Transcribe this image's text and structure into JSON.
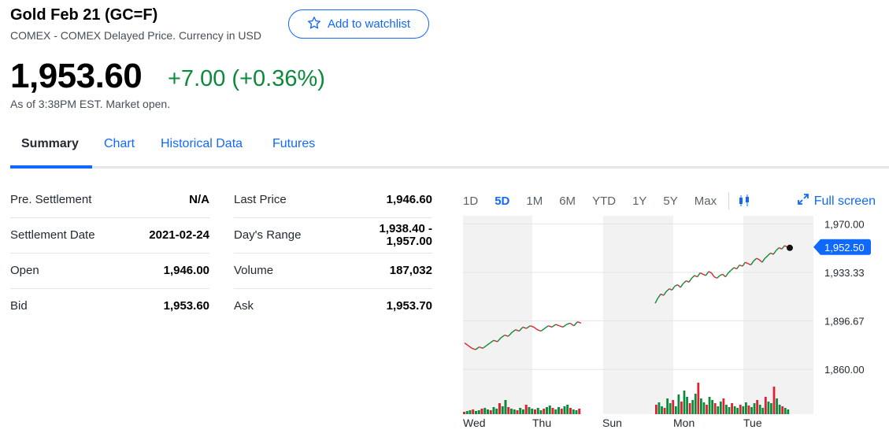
{
  "header": {
    "title": "Gold Feb 21 (GC=F)",
    "subtitle": "COMEX - COMEX Delayed Price. Currency in USD",
    "watchlist_label": "Add to watchlist",
    "price": "1,953.60",
    "change": "+7.00 (+0.36%)",
    "as_of": "As of 3:38PM EST. Market open."
  },
  "tabs": [
    {
      "label": "Summary",
      "active": true
    },
    {
      "label": "Chart"
    },
    {
      "label": "Historical Data"
    },
    {
      "label": "Futures"
    }
  ],
  "stats_left": [
    {
      "label": "Pre. Settlement",
      "value": "N/A"
    },
    {
      "label": "Settlement Date",
      "value": "2021-02-24"
    },
    {
      "label": "Open",
      "value": "1,946.00"
    },
    {
      "label": "Bid",
      "value": "1,953.60"
    }
  ],
  "stats_right": [
    {
      "label": "Last Price",
      "value": "1,946.60"
    },
    {
      "label": "Day's Range",
      "value": "1,938.40 -\n1,957.00"
    },
    {
      "label": "Volume",
      "value": "187,032"
    },
    {
      "label": "Ask",
      "value": "1,953.70"
    }
  ],
  "chart_controls": {
    "ranges": [
      "1D",
      "5D",
      "1M",
      "6M",
      "YTD",
      "1Y",
      "5Y",
      "Max"
    ],
    "active_range": "5D",
    "full_screen_label": "Full screen",
    "chart_type_icon": "candlestick-icon"
  },
  "chart_data": {
    "type": "line",
    "y_ticks": [
      "1,970.00",
      "1,933.33",
      "1,896.67",
      "1,860.00"
    ],
    "y_tick_values": [
      1970.0,
      1933.33,
      1896.67,
      1860.0
    ],
    "ylim": [
      1850,
      1975
    ],
    "x_labels": [
      "Wed",
      "Thu",
      "Sun",
      "Mon",
      "Tue"
    ],
    "current_price_label": "1,952.50",
    "current_price": 1952.5,
    "colors": {
      "up": "#0a8a3a",
      "down": "#e0202f",
      "accent": "#0f69ff",
      "shade": "#f0f0f0"
    },
    "series": [
      {
        "values": [
          1880,
          1878,
          1876,
          1875,
          1877,
          1876,
          1878,
          1880,
          1882,
          1881,
          1884,
          1886,
          1885,
          1888,
          1890,
          1889,
          1892,
          1891,
          1893,
          1892,
          1890,
          1889,
          1891,
          1893,
          1892,
          1894,
          1893,
          1892,
          1894,
          1895,
          1893,
          1896,
          1895
        ]
      },
      {
        "values": [
          1910,
          1914,
          1917,
          1916,
          1919,
          1921,
          1920,
          1923,
          1924,
          1922,
          1925,
          1927,
          1926,
          1929,
          1931,
          1930,
          1933,
          1932,
          1931,
          1934,
          1933,
          1930,
          1929,
          1931,
          1932,
          1930,
          1933,
          1935,
          1937,
          1936,
          1939,
          1938,
          1941,
          1940,
          1939,
          1942,
          1944,
          1943,
          1941,
          1944,
          1946,
          1948,
          1947,
          1950,
          1952,
          1951,
          1953.6,
          1952.5
        ]
      }
    ],
    "volumes": [
      [
        3,
        4,
        5,
        6,
        4,
        5,
        7,
        8,
        6,
        5,
        9,
        7,
        14,
        10,
        18,
        9,
        7,
        6,
        5,
        8,
        6,
        12,
        9,
        7,
        6,
        8,
        5,
        7,
        9,
        11,
        8,
        6,
        9,
        7,
        10,
        12,
        8,
        6,
        5,
        7
      ],
      [
        12,
        15,
        10,
        8,
        20,
        14,
        18,
        10,
        25,
        16,
        30,
        22,
        14,
        18,
        26,
        40,
        20,
        15,
        12,
        22,
        18,
        14,
        10,
        16,
        20,
        12,
        9,
        14,
        10,
        8,
        12,
        10,
        15,
        11,
        9,
        14,
        18,
        12,
        8,
        22,
        16,
        14,
        35,
        20,
        12,
        10,
        8,
        6
      ]
    ]
  }
}
